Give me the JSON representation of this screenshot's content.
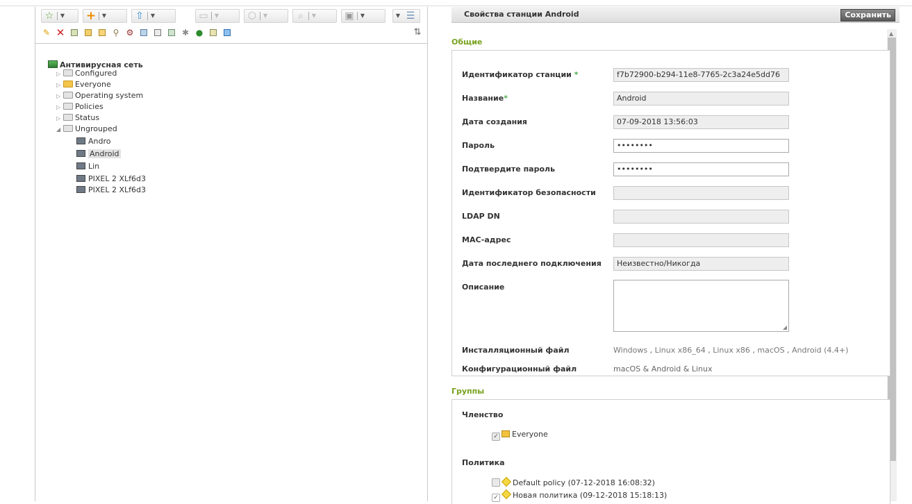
{
  "tree": {
    "root_label": "Антивирусная сеть",
    "nodes": [
      {
        "label": "Configured"
      },
      {
        "label": "Everyone"
      },
      {
        "label": "Operating system"
      },
      {
        "label": "Policies"
      },
      {
        "label": "Status"
      },
      {
        "label": "Ungrouped"
      }
    ],
    "stations": [
      {
        "label": "Andro"
      },
      {
        "label": "Android"
      },
      {
        "label": "Lin"
      },
      {
        "label": "PIXEL 2 XLf6d3"
      },
      {
        "label": "PIXEL 2 XLf6d3"
      }
    ]
  },
  "panel": {
    "title": "Свойства станции Android",
    "save_label": "Сохранить"
  },
  "general": {
    "section_title": "Общие",
    "station_id_label": "Идентификатор станции",
    "station_id_value": "f7b72900-b294-11e8-7765-2c3a24e5dd76",
    "name_label": "Название",
    "name_value": "Android",
    "created_label": "Дата создания",
    "created_value": "07-09-2018 13:56:03",
    "password_label": "Пароль",
    "password_value": "••••••••",
    "confirm_label": "Подтвердите пароль",
    "confirm_value": "••••••••",
    "security_id_label": "Идентификатор безопасности",
    "ldap_label": "LDAP DN",
    "mac_label": "MAC-адрес",
    "last_conn_label": "Дата последнего подключения",
    "last_conn_value": "Неизвестно/Никогда",
    "description_label": "Описание",
    "install_label": "Инсталляционный файл",
    "install_links": [
      "Windows",
      "Linux x86_64",
      "Linux x86",
      "macOS",
      "Android (4.4+)"
    ],
    "install_separator": " , ",
    "config_label": "Конфигурационный файл",
    "config_value": "macOS & Android & Linux"
  },
  "groups": {
    "section_title": "Группы",
    "membership_label": "Членство",
    "membership_item": "Everyone",
    "policy_label": "Политика",
    "policies": [
      {
        "label": "Default policy (07-12-2018 16:08:32)",
        "checked": false
      },
      {
        "label": "Новая политика (09-12-2018 15:18:13)",
        "checked": true
      }
    ]
  },
  "icons": {
    "toolbar_row1": [
      "star-icon",
      "add-icon",
      "install-icon",
      "folder-icon",
      "box-icon",
      "search-icon",
      "monitor-icon",
      "tree-view-icon"
    ],
    "toolbar_row2": [
      "edit-icon",
      "delete-icon",
      "remove-station-icon",
      "group-icon",
      "group-add-icon",
      "merge-icon",
      "settings-icon",
      "message-icon",
      "export-icon",
      "scan-icon",
      "components-icon",
      "shield-icon",
      "report-icon",
      "update-icon",
      "sort-icon"
    ]
  },
  "colors": {
    "section_title": "#78a21e",
    "required_star": "#4caf50",
    "delete": "#cc1f1f",
    "save_button": "#6b6b6b"
  }
}
